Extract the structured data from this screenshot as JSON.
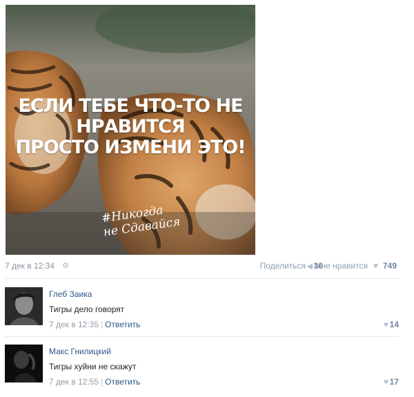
{
  "post": {
    "image_text_lines": [
      "ЕСЛИ ТЕБЕ ЧТО-ТО НЕ",
      "НРАВИТСЯ",
      "ПРОСТО ИЗМЕНИ ЭТО!"
    ],
    "image_signature_lines": [
      "#Никогда",
      "не Сдавайся"
    ],
    "date": "7 дек в 12:34",
    "share_label": "Поделиться",
    "share_count": "36",
    "like_label": "Мне нравится",
    "like_count": "749"
  },
  "comments": [
    {
      "author": "Глеб Заика",
      "text": "Тигры дело говорят",
      "date": "7 дек в 12:35",
      "reply_label": "Ответить",
      "likes": "14"
    },
    {
      "author": "Макс Гнилицкий",
      "text": "Тигры хуйни не скажут",
      "date": "7 дек в 12:55",
      "reply_label": "Ответить",
      "likes": "17"
    }
  ],
  "icons": {
    "gear": "gear-icon",
    "share": "megaphone-icon",
    "like": "heart-icon"
  },
  "colors": {
    "link": "#2a5885",
    "meta": "#939aa3",
    "count": "#6f87a6"
  }
}
